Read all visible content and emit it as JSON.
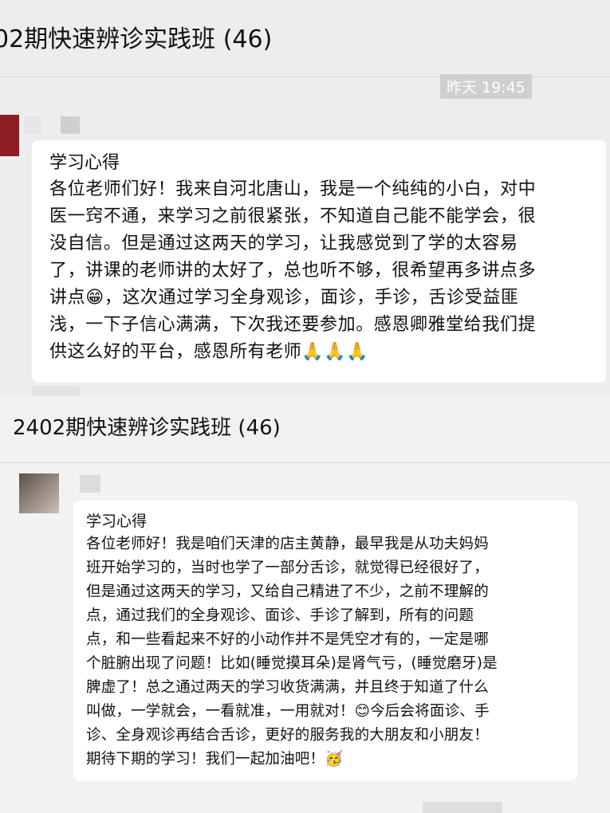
{
  "panel1": {
    "chat_title": "02期快速辨诊实践班 (46)",
    "timestamp": "昨天 19:45",
    "message_heading": "学习心得",
    "message_lines": [
      "各位老师们好！我来自河北唐山，我是一个纯纯的小白，对中",
      "医一窍不通，来学习之前很紧张，不知道自己能不能学会，很",
      "没自信。但是通过这两天的学习，让我感觉到了学的太容易",
      "了，讲课的老师讲的太好了，总也听不够，很希望再多讲点多",
      "讲点😁，这次通过学习全身观诊，面诊，手诊，舌诊受益匪",
      "浅，一下子信心满满，下次我还要参加。感恩卿雅堂给我们提",
      "供这么好的平台，感恩所有老师🙏🙏🙏"
    ]
  },
  "panel2": {
    "chat_title": "2402期快速辨诊实践班 (46)",
    "message_heading": "学习心得",
    "message_lines": [
      "各位老师好！我是咱们天津的店主黄静，最早我是从功夫妈妈",
      "班开始学习的，当时也学了一部分舌诊，就觉得已经很好了，",
      "但是通过这两天的学习，又给自己精进了不少，之前不理解的",
      "点，通过我们的全身观诊、面诊、手诊了解到，所有的问题",
      "点，和一些看起来不好的小动作并不是凭空才有的，一定是哪",
      "个脏腑出现了问题！比如(睡觉摸耳朵)是肾气亏，(睡觉磨牙)是",
      "脾虚了！总之通过两天的学习收货满满，并且终于知道了什么",
      "叫做，一学就会，一看就准，一用就对！😊今后会将面诊、手",
      "诊、全身观诊再结合舌诊，更好的服务我的大朋友和小朋友！",
      "期待下期的学习！我们一起加油吧！🥳"
    ]
  }
}
